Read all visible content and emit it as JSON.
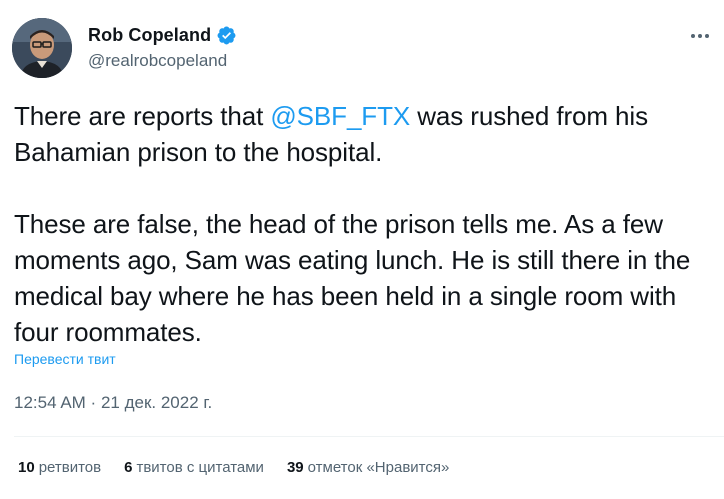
{
  "author": {
    "display_name": "Rob Copeland",
    "handle": "@realrobcopeland",
    "verified": true,
    "avatar_icon": "profile-photo"
  },
  "tweet": {
    "paragraph_1": {
      "before_mention": "There are reports that ",
      "mention": "@SBF_FTX",
      "after_mention": " was rushed from his Bahamian prison to the hospital."
    },
    "paragraph_2": "These are false, the head of the prison tells me. As a few moments ago, Sam was eating lunch. He is still there in the medical bay where he has been held in a single room with four roommates.",
    "translate_label": "Перевести твит",
    "time": "12:54 AM",
    "separator": " · ",
    "date": "21 дек. 2022 г."
  },
  "stats": {
    "retweets_count": "10",
    "retweets_label": "ретвитов",
    "quotes_count": "6",
    "quotes_label": "твитов с цитатами",
    "likes_count": "39",
    "likes_label": "отметок «Нравится»"
  },
  "colors": {
    "accent": "#1d9bf0",
    "text": "#0f1419",
    "secondary": "#536471",
    "divider": "#eff3f4"
  },
  "icons": {
    "verified": "verified-badge-icon",
    "more": "more-horizontal-icon"
  }
}
